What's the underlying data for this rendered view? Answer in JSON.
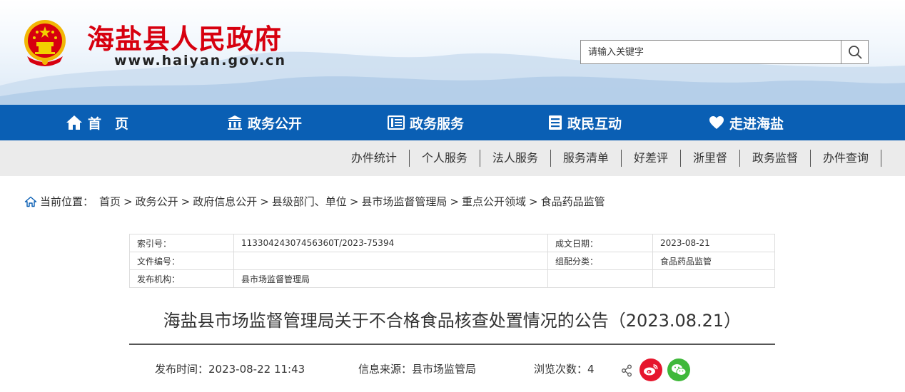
{
  "header": {
    "site_title": "海盐县人民政府",
    "site_url": "www.haiyan.gov.cn",
    "search_placeholder": "请输入关键字",
    "brand_red": "#d7000f"
  },
  "nav": {
    "color": "#0a5fb4",
    "items": [
      {
        "label": "首　页",
        "icon": "home-icon"
      },
      {
        "label": "政务公开",
        "icon": "building-icon"
      },
      {
        "label": "政务服务",
        "icon": "service-list-icon"
      },
      {
        "label": "政民互动",
        "icon": "document-icon"
      },
      {
        "label": "走进海盐",
        "icon": "heart-icon"
      }
    ]
  },
  "subnav": {
    "items": [
      "办件统计",
      "个人服务",
      "法人服务",
      "服务清单",
      "好差评",
      "浙里督",
      "政务监督",
      "办件查询"
    ]
  },
  "breadcrumb": {
    "prefix": "当前位置：",
    "items": [
      "首页",
      "政务公开",
      "政府信息公开",
      "县级部门、单位",
      "县市场监督管理局",
      "重点公开领域",
      "食品药品监管"
    ],
    "separator": ">"
  },
  "info": {
    "index_label": "索引号：",
    "index_value": "11330424307456360T/2023-75394",
    "date_label": "成文日期：",
    "date_value": "2023-08-21",
    "doc_no_label": "文件编号：",
    "doc_no_value": "",
    "category_label": "组配分类：",
    "category_value": "食品药品监管",
    "publisher_label": "发布机构：",
    "publisher_value": "县市场监督管理局"
  },
  "article": {
    "title": "海盐县市场监督管理局关于不合格食品核查处置情况的公告（2023.08.21）",
    "publish_time": "发布时间：2023-08-22 11:43",
    "source": "信息来源：县市场监管局",
    "views": "浏览次数：4"
  },
  "share": {
    "weibo_color": "#e6162d",
    "wechat_color": "#3fb83a"
  }
}
